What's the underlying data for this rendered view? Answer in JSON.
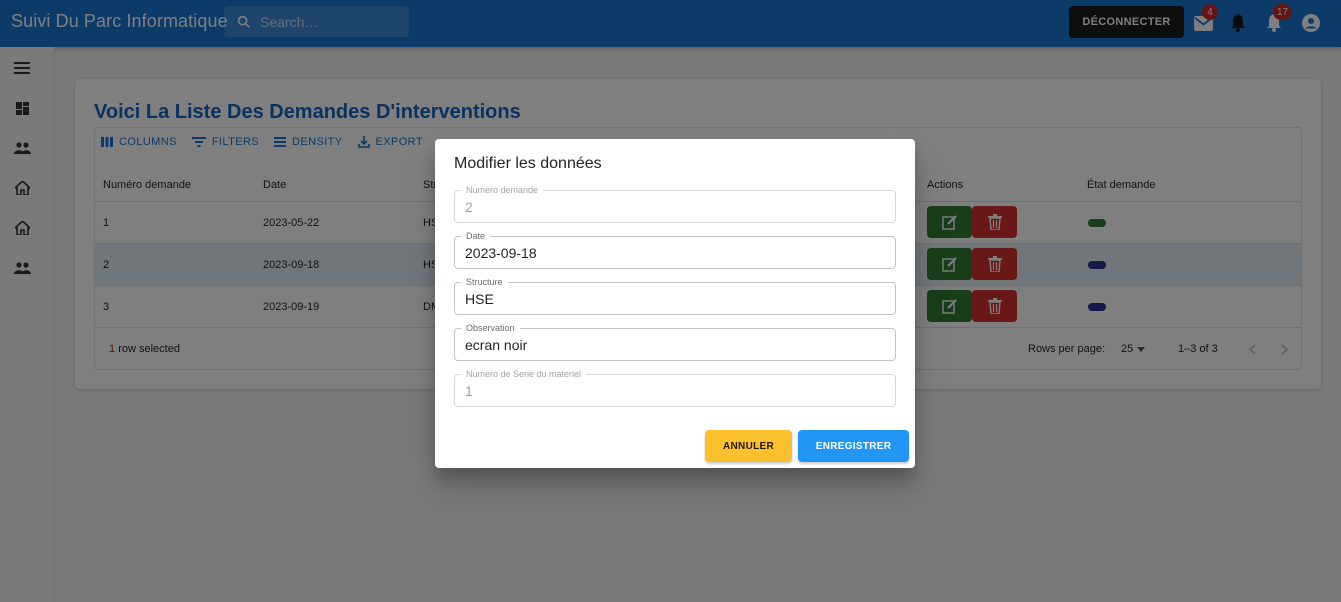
{
  "app": {
    "title": "Suivi Du Parc Informatique"
  },
  "header": {
    "search_placeholder": "Search…",
    "logout_label": "DÉCONNECTER",
    "mail_badge": "4",
    "notifications_badge": "17"
  },
  "sidebar": {
    "icons": [
      "menu-icon",
      "dashboard-icon",
      "people-icon",
      "home-icon",
      "home-icon",
      "people-icon"
    ]
  },
  "page": {
    "title": "Voici La Liste Des Demandes D'interventions"
  },
  "grid": {
    "toolbar": {
      "columns": "COLUMNS",
      "filters": "FILTERS",
      "density": "DENSITY",
      "export": "EXPORT"
    },
    "headers": {
      "numero": "Numéro demande",
      "date": "Date",
      "structure": "Stru",
      "actions": "Actions",
      "etat": "État demande"
    },
    "rows": [
      {
        "numero": "1",
        "date": "2023-05-22",
        "structure": "HS",
        "status_color": "#2e7d32",
        "selected": false
      },
      {
        "numero": "2",
        "date": "2023-09-18",
        "structure": "HS",
        "status_color": "#283593",
        "selected": true
      },
      {
        "numero": "3",
        "date": "2023-09-19",
        "structure": "DM",
        "status_color": "#283593",
        "selected": false
      }
    ],
    "footer": {
      "selected_count": "1",
      "selected_suffix": "row selected",
      "rows_per_page_label": "Rows per page:",
      "rows_per_page_value": "25",
      "range": "1–3 of 3"
    }
  },
  "dialog": {
    "title": "Modifier les données",
    "fields": {
      "numero": {
        "label": "Numero demande",
        "value": "2"
      },
      "date": {
        "label": "Date",
        "value": "2023-09-18"
      },
      "structure": {
        "label": "Structure",
        "value": "HSE"
      },
      "observation": {
        "label": "Observation",
        "value": "ecran noir"
      },
      "serie": {
        "label": "Numero de Serie du materiel",
        "value": "1"
      }
    },
    "cancel_label": "ANNULER",
    "save_label": "ENREGISTRER"
  },
  "colors": {
    "primary": "#1976d2",
    "edit": "#2e7d32",
    "delete": "#d32f2f",
    "cancel": "#fbc02d",
    "save": "#2196f3"
  }
}
